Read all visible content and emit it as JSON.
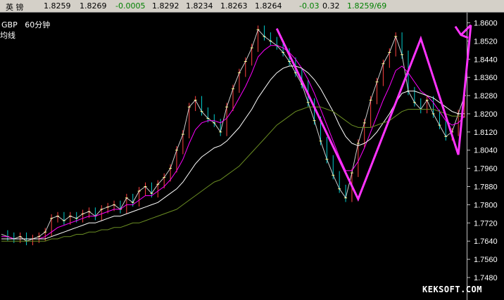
{
  "quote": {
    "name": "英 镑",
    "values": [
      "1.8259",
      "1.8269",
      "-0.0005",
      "1.8292",
      "1.8234",
      "1.8263",
      "1.8264",
      "-0.03",
      "0.32",
      "1.8259/69"
    ]
  },
  "header": {
    "symbol": "GBP",
    "period": "60分钟",
    "ma_label": "均线"
  },
  "watermark": "KEKSOFT.COM",
  "chart_data": {
    "type": "line",
    "title": "",
    "ylim": [
      1.748,
      1.862
    ],
    "yticks": [
      "1.8600",
      "1.8520",
      "1.8440",
      "1.8360",
      "1.8280",
      "1.8200",
      "1.8120",
      "1.8040",
      "1.7960",
      "1.7880",
      "1.7800",
      "1.7720",
      "1.7640",
      "1.7560",
      "1.7480"
    ],
    "grid": true,
    "colors": {
      "price": "#ffffff",
      "ma_fast": "#ff00ff",
      "ma_mid": "#ffffff",
      "ma_slow": "#6b8e23",
      "zigzag": "#ff33ff",
      "up_bar": "#ff4040",
      "down_bar": "#00cccc"
    },
    "series": [
      {
        "values": [
          1.767,
          1.766,
          1.765,
          1.766,
          1.764,
          1.765,
          1.766,
          1.768,
          1.774,
          1.775,
          1.773,
          1.775,
          1.774,
          1.776,
          1.777,
          1.775,
          1.778,
          1.779,
          1.78,
          1.778,
          1.783,
          1.781,
          1.786,
          1.788,
          1.785,
          1.789,
          1.792,
          1.796,
          1.804,
          1.811,
          1.823,
          1.826,
          1.821,
          1.818,
          1.816,
          1.812,
          1.823,
          1.831,
          1.838,
          1.843,
          1.849,
          1.857,
          1.854,
          1.852,
          1.85,
          1.847,
          1.843,
          1.838,
          1.833,
          1.825,
          1.817,
          1.808,
          1.8,
          1.793,
          1.787,
          1.783,
          1.794,
          1.807,
          1.816,
          1.826,
          1.834,
          1.842,
          1.847,
          1.854,
          1.846,
          1.83,
          1.825,
          1.822,
          1.826,
          1.82,
          1.815,
          1.81,
          1.812,
          1.82,
          1.828
        ]
      },
      {
        "values": [
          1.766,
          1.766,
          1.765,
          1.765,
          1.765,
          1.765,
          1.765,
          1.766,
          1.768,
          1.77,
          1.771,
          1.772,
          1.773,
          1.774,
          1.775,
          1.775,
          1.776,
          1.777,
          1.778,
          1.778,
          1.78,
          1.78,
          1.782,
          1.784,
          1.784,
          1.786,
          1.788,
          1.791,
          1.795,
          1.8,
          1.807,
          1.813,
          1.816,
          1.817,
          1.817,
          1.816,
          1.818,
          1.822,
          1.827,
          1.832,
          1.838,
          1.845,
          1.848,
          1.85,
          1.85,
          1.849,
          1.847,
          1.844,
          1.84,
          1.835,
          1.829,
          1.822,
          1.815,
          1.808,
          1.801,
          1.795,
          1.795,
          1.799,
          1.805,
          1.812,
          1.819,
          1.826,
          1.832,
          1.839,
          1.841,
          1.838,
          1.834,
          1.83,
          1.828,
          1.825,
          1.821,
          1.817,
          1.815,
          1.816,
          1.819
        ]
      },
      {
        "values": [
          1.765,
          1.765,
          1.765,
          1.765,
          1.765,
          1.765,
          1.765,
          1.765,
          1.766,
          1.767,
          1.768,
          1.769,
          1.77,
          1.771,
          1.772,
          1.772,
          1.773,
          1.774,
          1.775,
          1.775,
          1.776,
          1.777,
          1.778,
          1.779,
          1.78,
          1.781,
          1.783,
          1.785,
          1.787,
          1.79,
          1.794,
          1.798,
          1.801,
          1.803,
          1.805,
          1.806,
          1.808,
          1.811,
          1.814,
          1.818,
          1.822,
          1.827,
          1.831,
          1.835,
          1.838,
          1.84,
          1.841,
          1.841,
          1.84,
          1.838,
          1.835,
          1.831,
          1.826,
          1.821,
          1.815,
          1.81,
          1.807,
          1.806,
          1.807,
          1.809,
          1.812,
          1.816,
          1.82,
          1.825,
          1.829,
          1.83,
          1.83,
          1.829,
          1.828,
          1.827,
          1.825,
          1.823,
          1.821,
          1.82,
          1.82
        ]
      },
      {
        "values": [
          1.764,
          1.764,
          1.764,
          1.764,
          1.764,
          1.764,
          1.764,
          1.764,
          1.765,
          1.765,
          1.766,
          1.766,
          1.767,
          1.767,
          1.768,
          1.768,
          1.769,
          1.769,
          1.77,
          1.77,
          1.771,
          1.772,
          1.772,
          1.773,
          1.774,
          1.775,
          1.776,
          1.777,
          1.778,
          1.78,
          1.782,
          1.784,
          1.786,
          1.788,
          1.79,
          1.791,
          1.793,
          1.795,
          1.797,
          1.8,
          1.803,
          1.806,
          1.809,
          1.812,
          1.815,
          1.817,
          1.819,
          1.821,
          1.822,
          1.823,
          1.823,
          1.823,
          1.822,
          1.821,
          1.819,
          1.817,
          1.815,
          1.814,
          1.814,
          1.814,
          1.815,
          1.816,
          1.817,
          1.819,
          1.821,
          1.822,
          1.822,
          1.822,
          1.822,
          1.822,
          1.821,
          1.82,
          1.819,
          1.819,
          1.819
        ]
      }
    ],
    "zigzag": [
      {
        "x": 44,
        "y": 1.8575
      },
      {
        "x": 57,
        "y": 1.7825
      },
      {
        "x": 67,
        "y": 1.853
      },
      {
        "x": 73,
        "y": 1.802
      },
      {
        "x": 75,
        "y": 1.859
      }
    ]
  }
}
